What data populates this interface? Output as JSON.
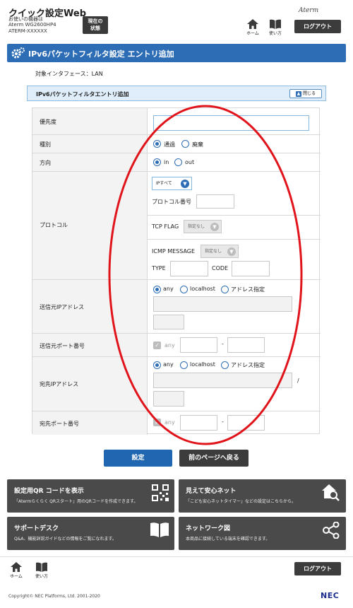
{
  "header": {
    "app_title": "クイック設定Web",
    "device_label": "お使いの機器は",
    "device_model": "Aterm WG2600HP4",
    "device_id": "ATERM-XXXXXX",
    "status_line1": "現在の",
    "status_line2": "状態",
    "home_label": "ホーム",
    "help_label": "使い方",
    "brand": "Aterm",
    "logout_label": "ログアウト"
  },
  "page": {
    "title": "IPv6パケットフィルタ設定 エントリ追加",
    "interface_label": "対象インタフェース：LAN",
    "section_title": "IPv6パケットフィルタエントリ追加",
    "close_label": "閉じる"
  },
  "form": {
    "priority": {
      "label": "優先度",
      "value": ""
    },
    "type": {
      "label": "種別",
      "options": [
        "通過",
        "廃棄"
      ],
      "selected": "通過"
    },
    "direction": {
      "label": "方向",
      "options": [
        "in",
        "out"
      ],
      "selected": "in"
    },
    "protocol": {
      "label": "プロトコル",
      "selected": "IPすべて",
      "number_label": "プロトコル番号",
      "number_value": "",
      "tcp_flag_label": "TCP FLAG",
      "tcp_flag_value": "指定なし",
      "icmp_label": "ICMP MESSAGE",
      "icmp_value": "指定なし",
      "type_label": "TYPE",
      "type_value": "",
      "code_label": "CODE",
      "code_value": ""
    },
    "src_ip": {
      "label": "送信元IPアドレス",
      "options": [
        "any",
        "localhost",
        "アドレス指定"
      ],
      "selected": "any",
      "address": "",
      "prefix": ""
    },
    "src_port": {
      "label": "送信元ポート番号",
      "any_label": "any",
      "from": "",
      "separator": "-",
      "to": ""
    },
    "dst_ip": {
      "label": "宛先IPアドレス",
      "options": [
        "any",
        "localhost",
        "アドレス指定"
      ],
      "selected": "any",
      "address": "",
      "slash": "/",
      "prefix": ""
    },
    "dst_port": {
      "label": "宛先ポート番号",
      "any_label": "any",
      "from": "",
      "separator": "-",
      "to": ""
    }
  },
  "actions": {
    "submit_label": "設定",
    "back_label": "前のページへ戻る"
  },
  "tiles": [
    {
      "title": "設定用QR コードを表示",
      "desc": "「Atermらくらく QRスタート」用のQRコードを作成できます。",
      "icon": "qr-code-icon"
    },
    {
      "title": "見えて安心ネット",
      "desc": "「こども安心ネットタイマー」などの設定はこちらから。",
      "icon": "home-search-icon"
    },
    {
      "title": "サポートデスク",
      "desc": "Q&A、機能詳説ガイドなどの情報をご覧になれます。",
      "icon": "book-icon"
    },
    {
      "title": "ネットワーク図",
      "desc": "本商品に接続している端末を確認できます。",
      "icon": "network-icon"
    }
  ],
  "footer": {
    "home_label": "ホーム",
    "help_label": "使い方",
    "logout_label": "ログアウト",
    "copyright": "Copyright© NEC Platforms, Ltd. 2001-2020",
    "brand": "NEC"
  },
  "colors": {
    "accent": "#2d6db5",
    "dark_button": "#3c3c3c",
    "tile": "#4a4a4a",
    "label_bg": "#f3f3f3"
  }
}
